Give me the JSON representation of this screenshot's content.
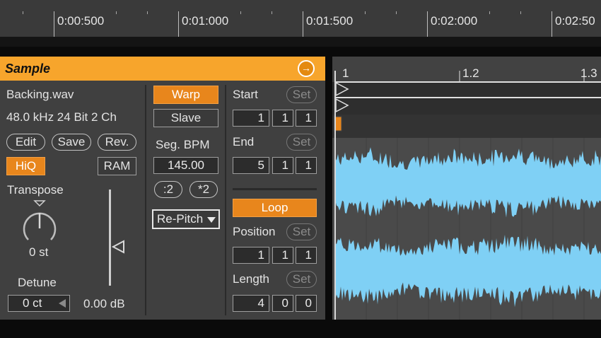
{
  "ruler": {
    "labels": [
      "0:00:500",
      "0:01:000",
      "0:01:500",
      "0:02:000",
      "0:02:50"
    ]
  },
  "sample": {
    "title": "Sample",
    "filename": "Backing.wav",
    "format": "48.0 kHz 24 Bit 2 Ch",
    "edit_label": "Edit",
    "save_label": "Save",
    "rev_label": "Rev.",
    "hiq_label": "HiQ",
    "ram_label": "RAM",
    "transpose_label": "Transpose",
    "transpose_value": "0 st",
    "detune_label": "Detune",
    "detune_value": "0 ct",
    "volume_value": "0.00 dB",
    "warp_label": "Warp",
    "slave_label": "Slave",
    "seg_bpm_label": "Seg. BPM",
    "seg_bpm_value": "145.00",
    "half_label": ":2",
    "double_label": "*2",
    "warp_mode": "Re-Pitch",
    "start_label": "Start",
    "start_set": "Set",
    "start_values": [
      "1",
      "1",
      "1"
    ],
    "end_label": "End",
    "end_set": "Set",
    "end_values": [
      "5",
      "1",
      "1"
    ],
    "loop_label": "Loop",
    "position_label": "Position",
    "position_set": "Set",
    "position_values": [
      "1",
      "1",
      "1"
    ],
    "length_label": "Length",
    "length_set": "Set",
    "length_values": [
      "4",
      "0",
      "0"
    ]
  },
  "waveform": {
    "labels": [
      "1",
      "1.2",
      "1.3"
    ],
    "wave_color": "#7fd0f5",
    "accent_color": "#e8861c"
  }
}
